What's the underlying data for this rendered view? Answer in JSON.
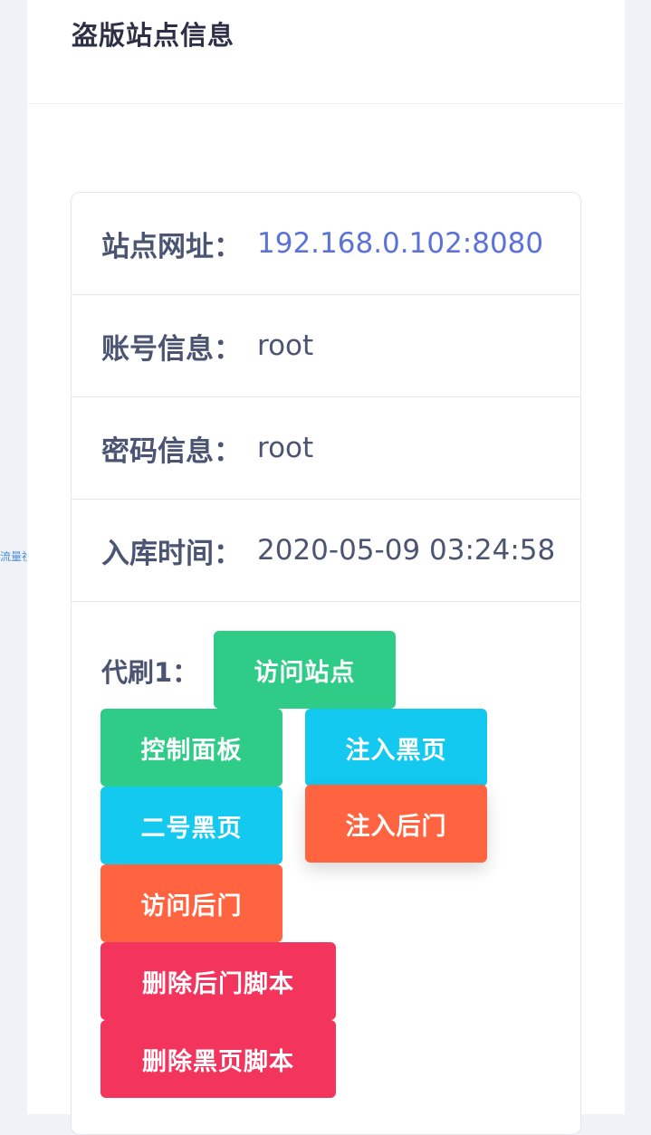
{
  "side_label": "流量社区",
  "header": {
    "title": "盗版站点信息"
  },
  "info": {
    "site_url_label": "站点网址：",
    "site_url_value": "192.168.0.102:8080",
    "account_label": "账号信息：",
    "account_value": "root",
    "password_label": "密码信息：",
    "password_value": "root",
    "time_label": "入库时间：",
    "time_value": "2020-05-09 03:24:58"
  },
  "actions": {
    "label": "代刷1：",
    "visit_site": "访问站点",
    "control_panel": "控制面板",
    "inject_black_page": "注入黑页",
    "black_page_2": "二号黑页",
    "inject_backdoor": "注入后门",
    "visit_backdoor": "访问后门",
    "delete_backdoor_script": "删除后门脚本",
    "delete_black_page_script": "删除黑页脚本"
  },
  "colors": {
    "green": "#2ecc87",
    "cyan": "#13c9ef",
    "orange": "#ff6340",
    "red": "#f3345d",
    "link": "#5a72d9"
  }
}
